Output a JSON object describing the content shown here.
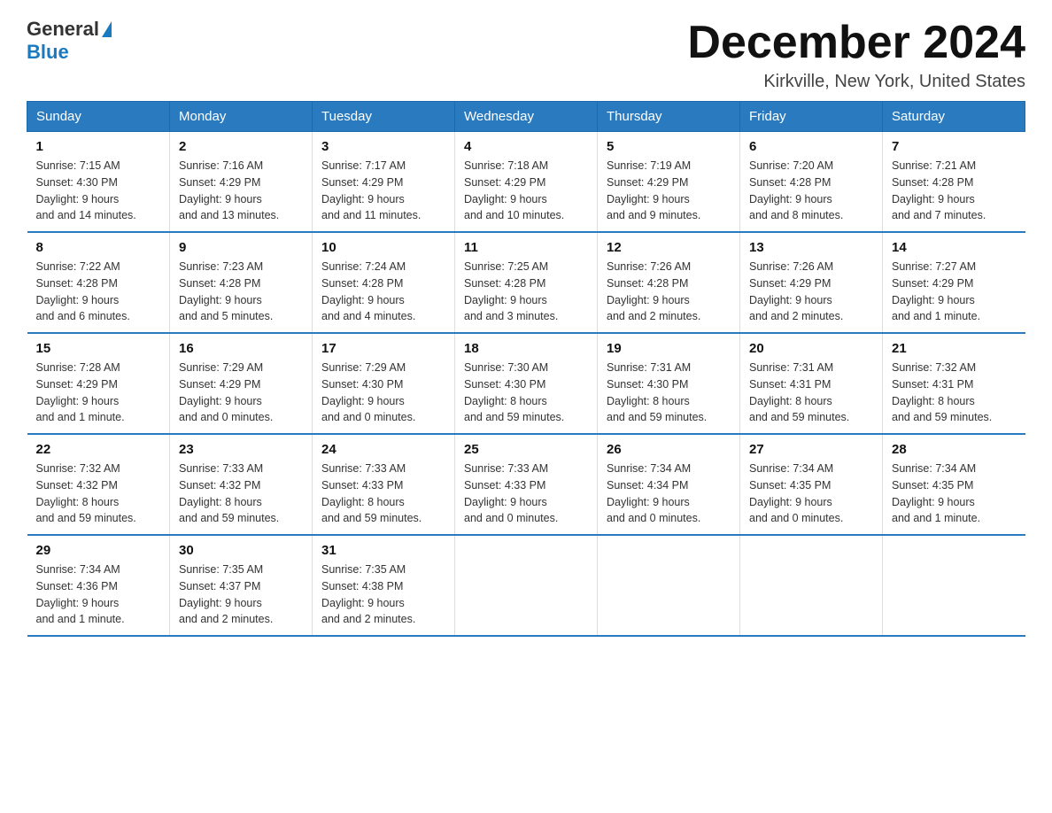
{
  "header": {
    "logo_general": "General",
    "logo_blue": "Blue",
    "month_title": "December 2024",
    "location": "Kirkville, New York, United States"
  },
  "days_of_week": [
    "Sunday",
    "Monday",
    "Tuesday",
    "Wednesday",
    "Thursday",
    "Friday",
    "Saturday"
  ],
  "weeks": [
    [
      {
        "day": "1",
        "sunrise": "7:15 AM",
        "sunset": "4:30 PM",
        "daylight": "9 hours and 14 minutes."
      },
      {
        "day": "2",
        "sunrise": "7:16 AM",
        "sunset": "4:29 PM",
        "daylight": "9 hours and 13 minutes."
      },
      {
        "day": "3",
        "sunrise": "7:17 AM",
        "sunset": "4:29 PM",
        "daylight": "9 hours and 11 minutes."
      },
      {
        "day": "4",
        "sunrise": "7:18 AM",
        "sunset": "4:29 PM",
        "daylight": "9 hours and 10 minutes."
      },
      {
        "day": "5",
        "sunrise": "7:19 AM",
        "sunset": "4:29 PM",
        "daylight": "9 hours and 9 minutes."
      },
      {
        "day": "6",
        "sunrise": "7:20 AM",
        "sunset": "4:28 PM",
        "daylight": "9 hours and 8 minutes."
      },
      {
        "day": "7",
        "sunrise": "7:21 AM",
        "sunset": "4:28 PM",
        "daylight": "9 hours and 7 minutes."
      }
    ],
    [
      {
        "day": "8",
        "sunrise": "7:22 AM",
        "sunset": "4:28 PM",
        "daylight": "9 hours and 6 minutes."
      },
      {
        "day": "9",
        "sunrise": "7:23 AM",
        "sunset": "4:28 PM",
        "daylight": "9 hours and 5 minutes."
      },
      {
        "day": "10",
        "sunrise": "7:24 AM",
        "sunset": "4:28 PM",
        "daylight": "9 hours and 4 minutes."
      },
      {
        "day": "11",
        "sunrise": "7:25 AM",
        "sunset": "4:28 PM",
        "daylight": "9 hours and 3 minutes."
      },
      {
        "day": "12",
        "sunrise": "7:26 AM",
        "sunset": "4:28 PM",
        "daylight": "9 hours and 2 minutes."
      },
      {
        "day": "13",
        "sunrise": "7:26 AM",
        "sunset": "4:29 PM",
        "daylight": "9 hours and 2 minutes."
      },
      {
        "day": "14",
        "sunrise": "7:27 AM",
        "sunset": "4:29 PM",
        "daylight": "9 hours and 1 minute."
      }
    ],
    [
      {
        "day": "15",
        "sunrise": "7:28 AM",
        "sunset": "4:29 PM",
        "daylight": "9 hours and 1 minute."
      },
      {
        "day": "16",
        "sunrise": "7:29 AM",
        "sunset": "4:29 PM",
        "daylight": "9 hours and 0 minutes."
      },
      {
        "day": "17",
        "sunrise": "7:29 AM",
        "sunset": "4:30 PM",
        "daylight": "9 hours and 0 minutes."
      },
      {
        "day": "18",
        "sunrise": "7:30 AM",
        "sunset": "4:30 PM",
        "daylight": "8 hours and 59 minutes."
      },
      {
        "day": "19",
        "sunrise": "7:31 AM",
        "sunset": "4:30 PM",
        "daylight": "8 hours and 59 minutes."
      },
      {
        "day": "20",
        "sunrise": "7:31 AM",
        "sunset": "4:31 PM",
        "daylight": "8 hours and 59 minutes."
      },
      {
        "day": "21",
        "sunrise": "7:32 AM",
        "sunset": "4:31 PM",
        "daylight": "8 hours and 59 minutes."
      }
    ],
    [
      {
        "day": "22",
        "sunrise": "7:32 AM",
        "sunset": "4:32 PM",
        "daylight": "8 hours and 59 minutes."
      },
      {
        "day": "23",
        "sunrise": "7:33 AM",
        "sunset": "4:32 PM",
        "daylight": "8 hours and 59 minutes."
      },
      {
        "day": "24",
        "sunrise": "7:33 AM",
        "sunset": "4:33 PM",
        "daylight": "8 hours and 59 minutes."
      },
      {
        "day": "25",
        "sunrise": "7:33 AM",
        "sunset": "4:33 PM",
        "daylight": "9 hours and 0 minutes."
      },
      {
        "day": "26",
        "sunrise": "7:34 AM",
        "sunset": "4:34 PM",
        "daylight": "9 hours and 0 minutes."
      },
      {
        "day": "27",
        "sunrise": "7:34 AM",
        "sunset": "4:35 PM",
        "daylight": "9 hours and 0 minutes."
      },
      {
        "day": "28",
        "sunrise": "7:34 AM",
        "sunset": "4:35 PM",
        "daylight": "9 hours and 1 minute."
      }
    ],
    [
      {
        "day": "29",
        "sunrise": "7:34 AM",
        "sunset": "4:36 PM",
        "daylight": "9 hours and 1 minute."
      },
      {
        "day": "30",
        "sunrise": "7:35 AM",
        "sunset": "4:37 PM",
        "daylight": "9 hours and 2 minutes."
      },
      {
        "day": "31",
        "sunrise": "7:35 AM",
        "sunset": "4:38 PM",
        "daylight": "9 hours and 2 minutes."
      },
      null,
      null,
      null,
      null
    ]
  ],
  "labels": {
    "sunrise": "Sunrise:",
    "sunset": "Sunset:",
    "daylight": "Daylight:"
  }
}
